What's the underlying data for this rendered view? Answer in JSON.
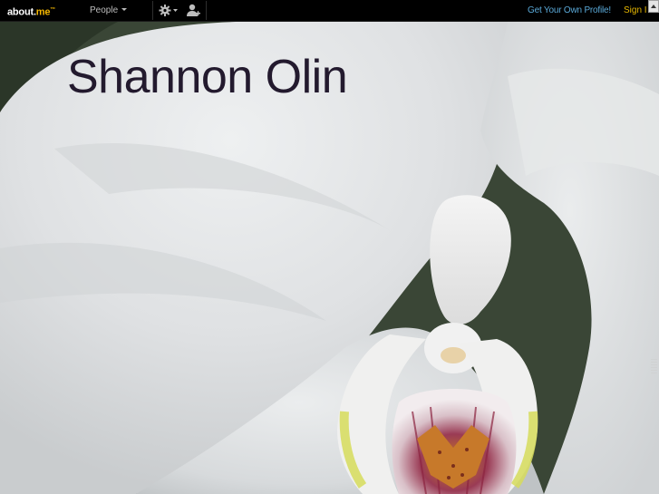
{
  "nav": {
    "logo_text": "about.",
    "logo_accent": "me",
    "logo_tm": "™",
    "people_label": "People",
    "gear_icon": "gear-icon",
    "user_icon": "user-icon",
    "get_profile_label": "Get Your Own Profile!",
    "sign_in_label": "Sign I"
  },
  "profile": {
    "name": "Shannon Olin"
  },
  "colors": {
    "nav_bg": "#000000",
    "link_blue": "#5aa9d8",
    "accent_yellow": "#f5b800",
    "title_text": "#231a2e"
  }
}
